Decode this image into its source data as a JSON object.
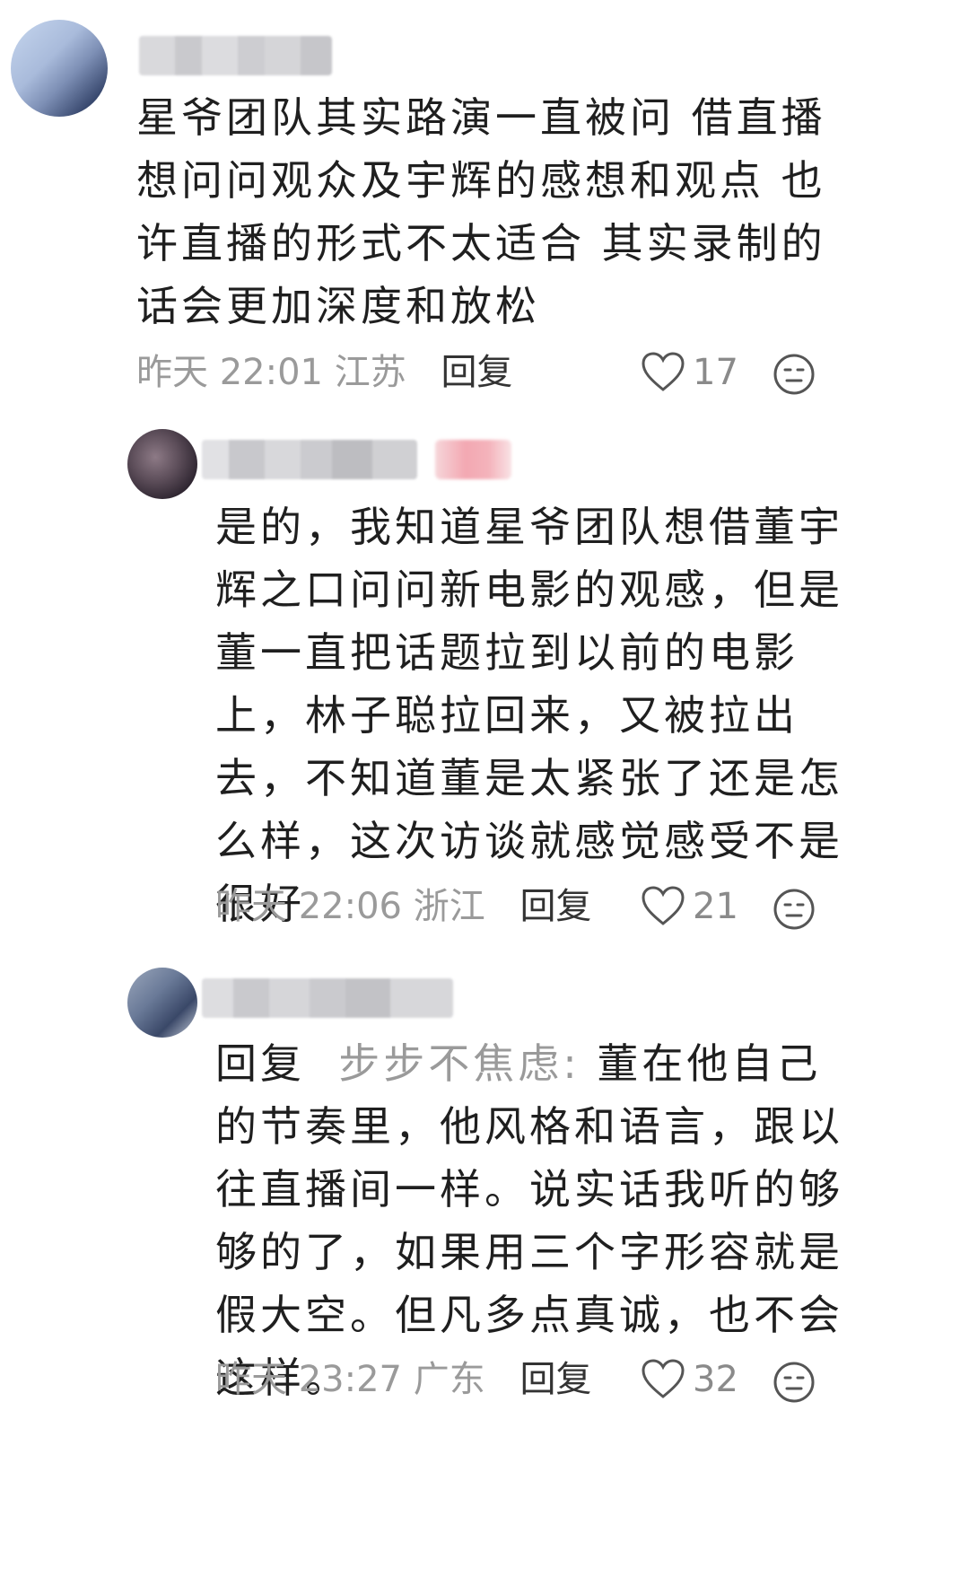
{
  "comments": [
    {
      "text": "星爷团队其实路演一直被问 借直播想问问观众及宇辉的感想和观点 也许直播的形式不太适合 其实录制的话会更加深度和放松",
      "time": "昨天 22:01",
      "location": "江苏",
      "reply_label": "回复",
      "likes": "17"
    },
    {
      "text": "是的，我知道星爷团队想借董宇辉之口问问新电影的观感，但是董一直把话题拉到以前的电影上，林子聪拉回来，又被拉出去，不知道董是太紧张了还是怎么样，这次访谈就感觉感受不是很好",
      "time": "昨天 22:06",
      "location": "浙江",
      "reply_label": "回复",
      "likes": "21"
    },
    {
      "reply_prefix": "回复",
      "reply_to": "步步不焦虑:",
      "text": "董在他自己的节奏里，他风格和语言，跟以往直播间一样。说实话我听的够够的了，如果用三个字形容就是假大空。但凡多点真诚，也不会这样。",
      "time": "昨天 23:27",
      "location": "广东",
      "reply_label": "回复",
      "likes": "32"
    }
  ],
  "icons": {
    "like": "heart-outline-icon",
    "emoji": "sad-face-icon"
  },
  "colors": {
    "text": "#1f1f1f",
    "meta": "#9a9a9a",
    "quoted": "#9a9a9a"
  }
}
